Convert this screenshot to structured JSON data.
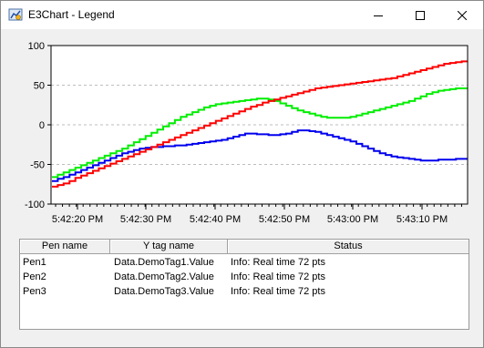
{
  "window": {
    "title": "E3Chart - Legend",
    "icon": "app-chart-icon",
    "controls": [
      "minimize-icon",
      "maximize-icon",
      "close-icon"
    ]
  },
  "chart_data": {
    "type": "line",
    "title": "",
    "xlabel": "",
    "ylabel": "",
    "ylim": [
      -100,
      100
    ],
    "y_ticks": [
      "100",
      "50",
      "0",
      "-50",
      "-100"
    ],
    "x_ticks": [
      "5:42:20 PM",
      "5:42:30 PM",
      "5:42:40 PM",
      "5:42:50 PM",
      "5:43:00 PM",
      "5:43:10 PM"
    ],
    "grid": true,
    "series": [
      {
        "name": "Pen1",
        "color": "#ff0000",
        "values": [
          -78,
          -76,
          -74,
          -71,
          -67,
          -64,
          -61,
          -58,
          -55,
          -52,
          -49,
          -46,
          -43,
          -40,
          -37,
          -34,
          -31,
          -28,
          -25,
          -22,
          -19,
          -16,
          -13,
          -10,
          -7,
          -4,
          -1,
          2,
          5,
          8,
          11,
          14,
          17,
          20,
          23,
          25,
          28,
          30,
          32,
          34,
          36,
          38,
          40,
          42,
          44,
          46,
          47,
          48,
          49,
          50,
          51,
          52,
          53,
          54,
          55,
          56,
          57,
          58,
          59,
          61,
          63,
          65,
          67,
          69,
          71,
          73,
          75,
          77,
          78,
          79,
          80,
          80
        ]
      },
      {
        "name": "Pen2",
        "color": "#00ee00",
        "values": [
          -66,
          -63,
          -60,
          -57,
          -54,
          -51,
          -48,
          -45,
          -42,
          -39,
          -36,
          -33,
          -30,
          -26,
          -22,
          -18,
          -14,
          -10,
          -6,
          -2,
          2,
          6,
          10,
          13,
          16,
          19,
          22,
          24,
          26,
          27,
          28,
          29,
          30,
          31,
          32,
          33,
          33,
          32,
          30,
          27,
          24,
          21,
          18,
          16,
          14,
          12,
          10,
          9,
          9,
          9,
          9,
          10,
          12,
          14,
          16,
          18,
          20,
          22,
          24,
          26,
          28,
          30,
          33,
          36,
          39,
          41,
          43,
          44,
          45,
          46,
          46,
          46
        ]
      },
      {
        "name": "Pen3",
        "color": "#0000ee",
        "values": [
          -71,
          -68,
          -66,
          -63,
          -60,
          -57,
          -54,
          -51,
          -48,
          -45,
          -42,
          -39,
          -36,
          -34,
          -32,
          -30,
          -29,
          -28,
          -28,
          -27,
          -27,
          -26,
          -26,
          -25,
          -24,
          -23,
          -22,
          -21,
          -20,
          -19,
          -17,
          -15,
          -13,
          -11,
          -11,
          -12,
          -12,
          -13,
          -13,
          -12,
          -11,
          -9,
          -7,
          -7,
          -8,
          -9,
          -11,
          -13,
          -15,
          -17,
          -19,
          -21,
          -24,
          -27,
          -30,
          -33,
          -36,
          -38,
          -40,
          -41,
          -42,
          -43,
          -44,
          -45,
          -45,
          -45,
          -44,
          -44,
          -44,
          -43,
          -43,
          -43
        ]
      }
    ]
  },
  "legend": {
    "columns": [
      "Pen name",
      "Y tag name",
      "Status"
    ],
    "rows": [
      {
        "pen": "Pen1",
        "tag": "Data.DemoTag1.Value",
        "status": "Info: Real time 72 pts"
      },
      {
        "pen": "Pen2",
        "tag": "Data.DemoTag2.Value",
        "status": "Info: Real time 72 pts"
      },
      {
        "pen": "Pen3",
        "tag": "Data.DemoTag3.Value",
        "status": "Info: Real time 72 pts"
      }
    ]
  }
}
